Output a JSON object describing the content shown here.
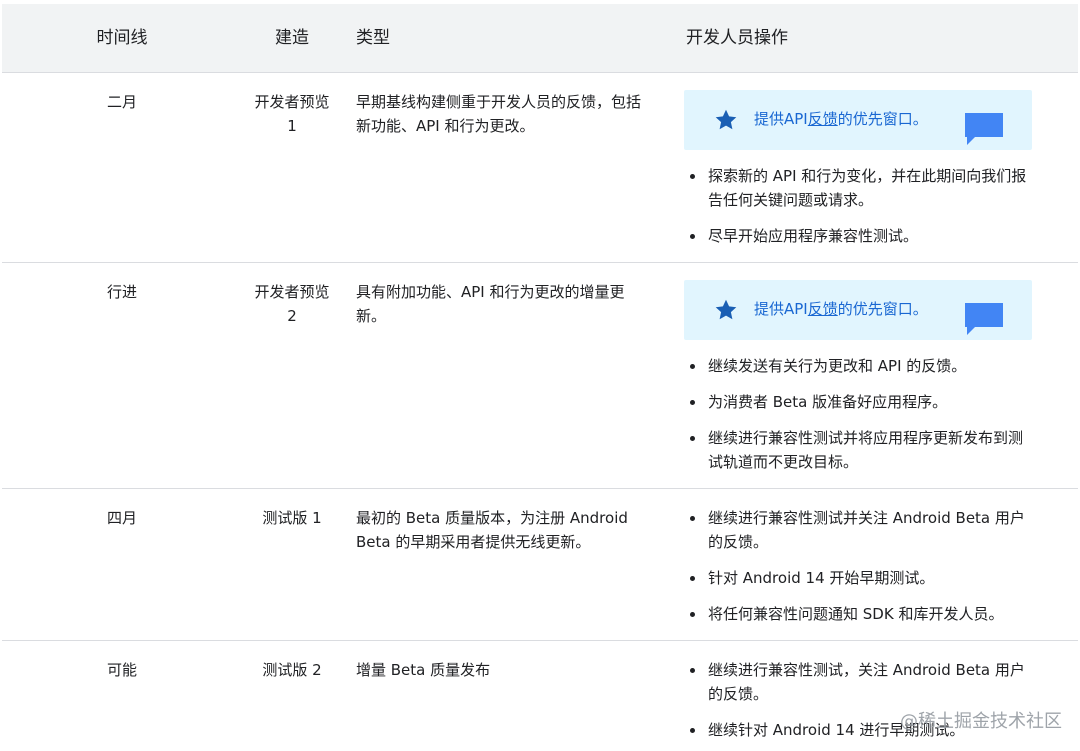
{
  "headers": {
    "timeline": "时间线",
    "build": "建造",
    "type": "类型",
    "actions": "开发人员操作"
  },
  "rows": [
    {
      "timeline": "二月",
      "build": "开发者预览 1",
      "type": "早期基线构建侧重于开发人员的反馈，包括新功能、API 和行为更改。",
      "callout": {
        "prefix": "提供API",
        "link": "反馈",
        "suffix": "的优先窗口。"
      },
      "actions": [
        "探索新的 API 和行为变化，并在此期间向我们报告任何关键问题或请求。",
        "尽早开始应用程序兼容性测试。"
      ]
    },
    {
      "timeline": "行进",
      "build": "开发者预览 2",
      "type": "具有附加功能、API 和行为更改的增量更新。",
      "callout": {
        "prefix": "提供API",
        "link": "反馈",
        "suffix": "的优先窗口。"
      },
      "actions": [
        "继续发送有关行为更改和 API 的反馈。",
        "为消费者 Beta 版准备好应用程序。",
        "继续进行兼容性测试并将应用程序更新发布到测试轨道而不更改目标。"
      ]
    },
    {
      "timeline": "四月",
      "build": "测试版 1",
      "type": "最初的 Beta 质量版本，为注册 Android Beta 的早期采用者提供无线更新。",
      "actions": [
        "继续进行兼容性测试并关注 Android Beta 用户的反馈。",
        "针对 Android 14 开始早期测试。",
        "将任何兼容性问题通知 SDK 和库开发人员。"
      ]
    },
    {
      "timeline": "可能",
      "build": "测试版 2",
      "type": "增量 Beta 质量发布",
      "actions": [
        "继续进行兼容性测试，关注 Android Beta 用户的反馈。",
        "继续针对 Android 14 进行早期测试。"
      ]
    }
  ],
  "watermark": "@稀土掘金技术社区",
  "colors": {
    "header_bg": "#f1f3f4",
    "callout_bg": "#e1f5fe",
    "link": "#1967d2",
    "star": "#1a5fb4",
    "feedback_icon": "#4285f4",
    "divider": "#dadce0"
  }
}
